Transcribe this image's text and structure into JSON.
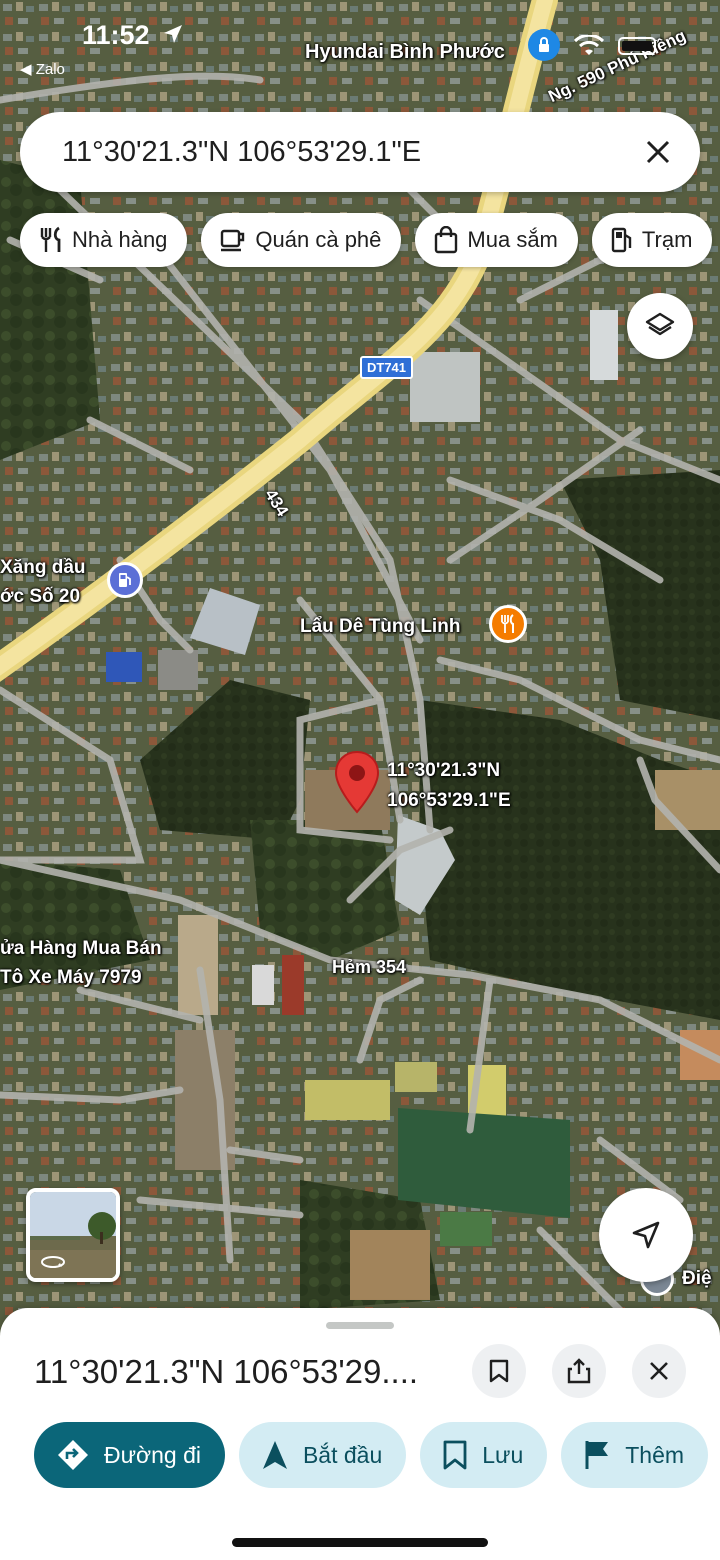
{
  "status_bar": {
    "time": "11:52",
    "back_app": "◀ Zalo"
  },
  "search": {
    "value": "11°30'21.3\"N 106°53'29.1\"E"
  },
  "chips": [
    {
      "label": "Nhà hàng",
      "icon": "fork-knife-icon"
    },
    {
      "label": "Quán cà phê",
      "icon": "coffee-cup-icon"
    },
    {
      "label": "Mua sắm",
      "icon": "shopping-bag-icon"
    },
    {
      "label": "Trạm",
      "icon": "gas-pump-icon"
    }
  ],
  "map": {
    "labels": {
      "hyundai": "Hyundai Bình Phước",
      "street_top": "Ng. 590 Phú Riềng",
      "route_shield": "DT741",
      "route_434": "434",
      "gas_station_line1": "Xăng dầu",
      "gas_station_line2": "ớc Số 20",
      "restaurant": "Lẩu Dê Tùng Linh",
      "pin_lat": "11°30'21.3\"N",
      "pin_lng": "106°53'29.1\"E",
      "shop_line1": "ửa Hàng Mua Bán",
      "shop_line2": "Tô Xe Máy 7979",
      "alley": "Hẻm 354",
      "electric": "Điệ"
    },
    "colors": {
      "pin": "#e53935",
      "road_major": "#f2dc8c",
      "road_minor": "#b8b8b8",
      "route_shield": "#2f6fd6",
      "poi_restaurant": "#f57c00",
      "poi_gas": "#5b6fd6"
    }
  },
  "place": {
    "title": "11°30'21.3\"N 106°53'29...."
  },
  "actions": [
    {
      "label": "Đường đi",
      "icon": "directions-icon"
    },
    {
      "label": "Bắt đầu",
      "icon": "navigation-arrow-icon"
    },
    {
      "label": "Lưu",
      "icon": "bookmark-icon"
    },
    {
      "label": "Thêm",
      "icon": "flag-icon"
    }
  ]
}
